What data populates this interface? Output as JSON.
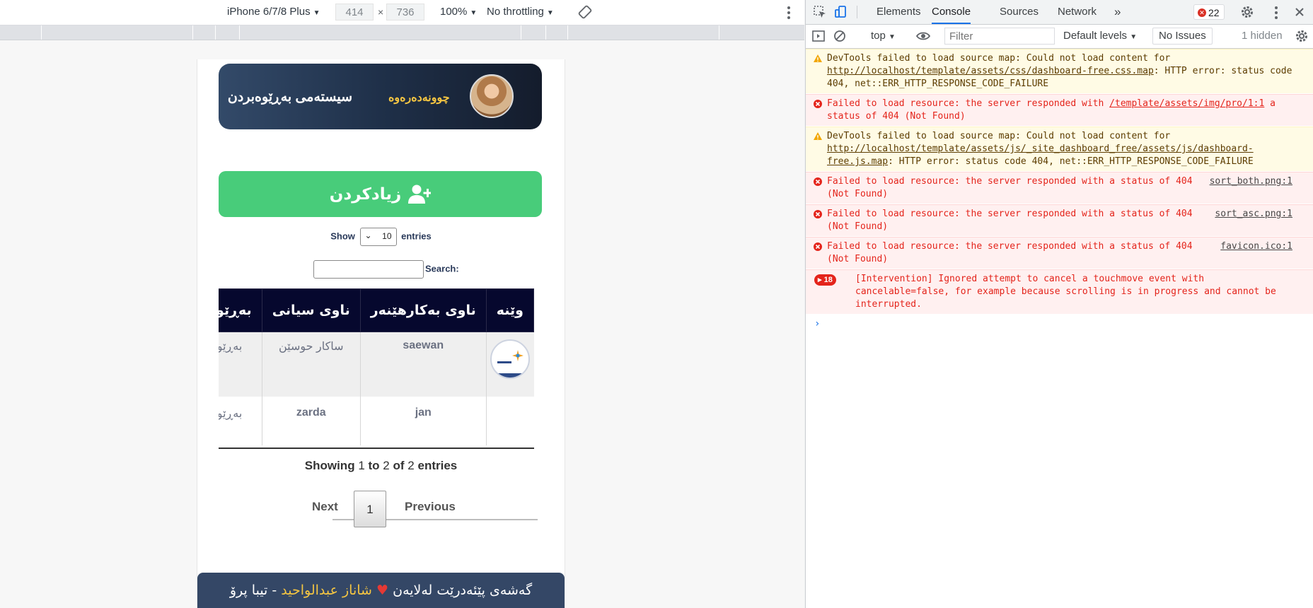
{
  "device_toolbar": {
    "device": "iPhone 6/7/8 Plus",
    "width": "414",
    "height": "736",
    "times": "×",
    "zoom": "100%",
    "throttling": "No throttling"
  },
  "page": {
    "header_title": "سیستەمی بەڕێوەبردن",
    "logout_label": "چوونەدەرەوە",
    "add_button_label": "زیادکردن",
    "show_label": "Show",
    "entries_count": "10",
    "entries_label": "entries",
    "search_label": "Search:",
    "table": {
      "headers": [
        "وێنە",
        "ناوی بەکارهێنەر",
        "ناوی سیانی",
        "بەڕێوەبەر"
      ],
      "rows": [
        {
          "username": "saewan",
          "fullname": "ساکار حوسێن",
          "role": "بەڕێوەبەر"
        },
        {
          "username": "jan",
          "fullname": "zarda",
          "role": "بەڕێوەبەر"
        }
      ]
    },
    "showing": {
      "prefix": "Showing",
      "from": "1",
      "to_label": "to",
      "to": "2",
      "of_label": "of",
      "total": "2",
      "suffix": "entries"
    },
    "pager": {
      "next": "Next",
      "page": "1",
      "previous": "Previous"
    },
    "footer": {
      "before": "گەشەی پێئەدرێت لەلایەن",
      "heart": "♥",
      "name": "شاناز عبدالواحید",
      "after": "- تیبا پرۆ"
    }
  },
  "devtools": {
    "tabs": [
      "Elements",
      "Console",
      "Sources",
      "Network"
    ],
    "more": "»",
    "error_count": "22",
    "context": "top",
    "filter_placeholder": "Filter",
    "levels": "Default levels",
    "issues": "No Issues",
    "hidden": "1 hidden",
    "messages": [
      {
        "type": "warn",
        "text": "DevTools failed to load source map: Could not load content for ",
        "link": "http://localhost/template/assets/css/dashboard-free.css.map",
        "tail": ": HTTP error: status code 404, net::ERR_HTTP_RESPONSE_CODE_FAILURE"
      },
      {
        "type": "error",
        "text": "Failed to load resource: the server responded with ",
        "link": "/template/assets/img/pro/1:1",
        "tail": " a status of 404 (Not Found)"
      },
      {
        "type": "warn",
        "text": "DevTools failed to load source map: Could not load content for ",
        "link": "http://localhost/template/assets/js/_site_dashboard_free/assets/js/dashboard-free.js.map",
        "tail": ": HTTP error: status code 404, net::ERR_HTTP_RESPONSE_CODE_FAILURE"
      },
      {
        "type": "error",
        "text": "Failed to load resource: the server responded with a status of 404 (Not Found)",
        "src": "sort_both.png:1"
      },
      {
        "type": "error",
        "text": "Failed to load resource: the server responded with a status of 404 (Not Found)",
        "src": "sort_asc.png:1"
      },
      {
        "type": "error",
        "text": "Failed to load resource: the server responded with a status of 404 (Not Found)",
        "src": "favicon.ico:1"
      },
      {
        "type": "error",
        "count": "18",
        "text": "[Intervention] Ignored attempt to cancel a touchmove event with cancelable=false, for example because scrolling is in progress and cannot be interrupted."
      }
    ],
    "prompt": "›"
  },
  "colors": {
    "header_gradient_start": "#334a69",
    "header_gradient_end": "#141c2c",
    "add_button": "#48cc7a",
    "table_header": "#06082e",
    "footer": "#344766",
    "accent_yellow": "#f4c542",
    "devtools_active_tab": "#1a73e8",
    "error_red": "#e4241b"
  }
}
